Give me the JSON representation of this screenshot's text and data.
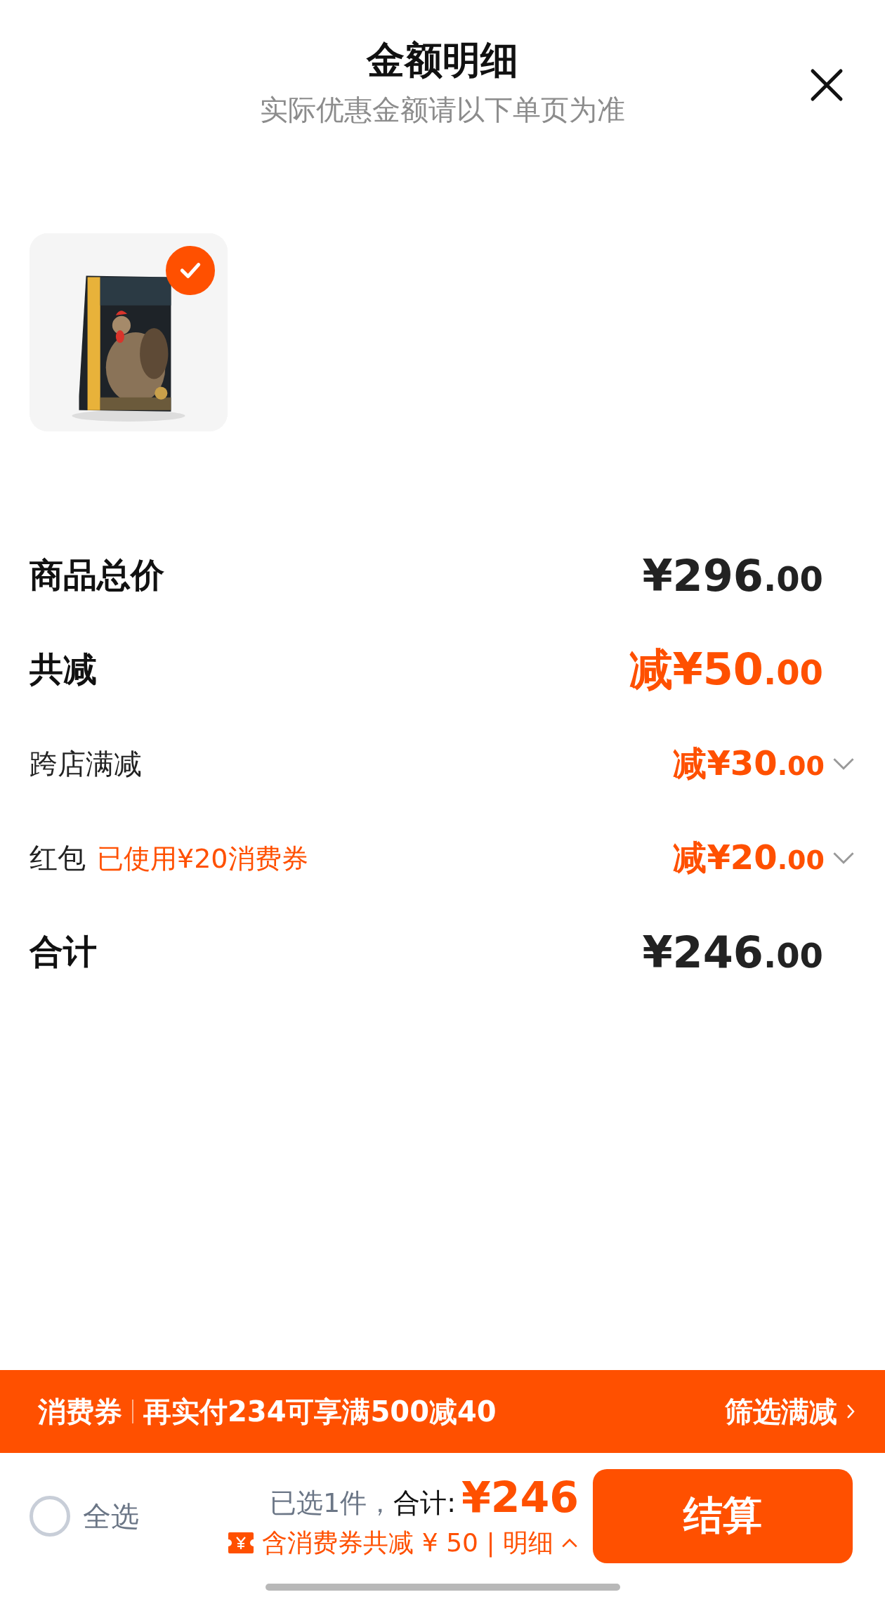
{
  "header": {
    "title": "金额明细",
    "subtitle": "实际优惠金额请以下单页为准"
  },
  "products": [
    {
      "kind": "picture",
      "selected": true
    }
  ],
  "rows": [
    {
      "kind": "total",
      "label": "商品总价",
      "amount": "¥296.00"
    },
    {
      "kind": "discount",
      "label": "共减",
      "amount": "减¥50.00"
    },
    {
      "kind": "detail",
      "label": "跨店满减",
      "amount": "减¥30.00",
      "expanded": false
    },
    {
      "kind": "detail",
      "label": "红包",
      "note": "已使用¥20消费券",
      "amount": "减¥20.00",
      "expanded": false
    },
    {
      "kind": "total",
      "label": "合计",
      "amount": "¥246.00"
    }
  ],
  "coupon_banner": {
    "tag": "消费券",
    "message": "再实付234可享满500减40",
    "action": "筛选满减"
  },
  "footer": {
    "select_all": {
      "label": "全选",
      "checked": false
    },
    "selected_count": "已选1件，",
    "total_label": "合计:",
    "total": "¥246",
    "savings": "含消费券共减 ¥ 50 | 明细",
    "savings_expanded": false,
    "checkout": "结算"
  }
}
